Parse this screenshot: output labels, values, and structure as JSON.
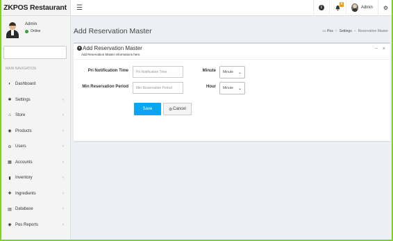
{
  "app": {
    "logo_text": "ZKPOS Restaurant",
    "menu_icon": "hamburger-icon"
  },
  "topbar": {
    "info_icon": "info-icon",
    "notifications_badge": "4",
    "user_name": "Admin",
    "settings_icon": "gears-icon"
  },
  "sidebar": {
    "user": {
      "name": "Admin",
      "status": "Online"
    },
    "nav_header": "MAIN NAVIGATION",
    "items": [
      {
        "label": "Dashboard",
        "icon": "dashboard-icon",
        "glyph": "◐",
        "has_children": false
      },
      {
        "label": "Settings",
        "icon": "gear-icon",
        "glyph": "✱",
        "has_children": true
      },
      {
        "label": "Store",
        "icon": "home-icon",
        "glyph": "⌂",
        "has_children": true
      },
      {
        "label": "Products",
        "icon": "tag-icon",
        "glyph": "◉",
        "has_children": true
      },
      {
        "label": "Users",
        "icon": "user-icon",
        "glyph": "⊖",
        "has_children": true
      },
      {
        "label": "Accounts",
        "icon": "calculator-icon",
        "glyph": "▦",
        "has_children": true
      },
      {
        "label": "Inventory",
        "icon": "bar-chart-icon",
        "glyph": "▮",
        "has_children": true
      },
      {
        "label": "Ingredients",
        "icon": "plus-icon",
        "glyph": "✚",
        "has_children": true
      },
      {
        "label": "Database",
        "icon": "database-icon",
        "glyph": "▤",
        "has_children": true
      },
      {
        "label": "Pos Reports",
        "icon": "eye-icon",
        "glyph": "◉",
        "has_children": true
      }
    ],
    "chevron": "‹"
  },
  "main": {
    "page_title": "Add Reservation Master",
    "breadcrumb": [
      "Pos",
      "Settings",
      "Reservation Master"
    ],
    "box": {
      "title": "Add Reservation Master",
      "subtitle": "Add Reservation Master informations here.",
      "tools": [
        "−",
        "×"
      ],
      "fields": {
        "pri_notification_time": {
          "label": "Pri Notification Time",
          "placeholder": "Pri Notification Time",
          "unit_label": "Minute",
          "unit_value": "Minute"
        },
        "min_reservation_period": {
          "label": "Min Reservation Period",
          "placeholder": "Min Reservation Period",
          "unit_label": "Hour",
          "unit_value": "Minute"
        }
      },
      "save_label": "Save",
      "cancel_label": "Cancel"
    }
  },
  "colors": {
    "primary": "#0aa7f0",
    "online": "#3c9d3c",
    "badge": "#f39c12",
    "content_bg": "#ecf0f5",
    "sidebar_bg": "#f4f4f4"
  }
}
